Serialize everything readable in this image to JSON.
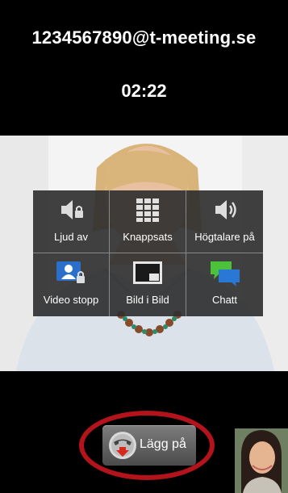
{
  "call": {
    "address": "1234567890@t-meeting.se",
    "duration": "02:22"
  },
  "controls": [
    {
      "label": "Ljud av",
      "icon": "mute-speaker-lock-icon"
    },
    {
      "label": "Knappsats",
      "icon": "keypad-icon"
    },
    {
      "label": "Högtalare på",
      "icon": "speaker-on-icon"
    },
    {
      "label": "Video stopp",
      "icon": "video-stop-icon"
    },
    {
      "label": "Bild i Bild",
      "icon": "picture-in-picture-icon"
    },
    {
      "label": "Chatt",
      "icon": "chat-icon"
    }
  ],
  "hangup": {
    "label": "Lägg på",
    "icon": "hangup-phone-icon",
    "highlight_color": "#b3131a"
  }
}
